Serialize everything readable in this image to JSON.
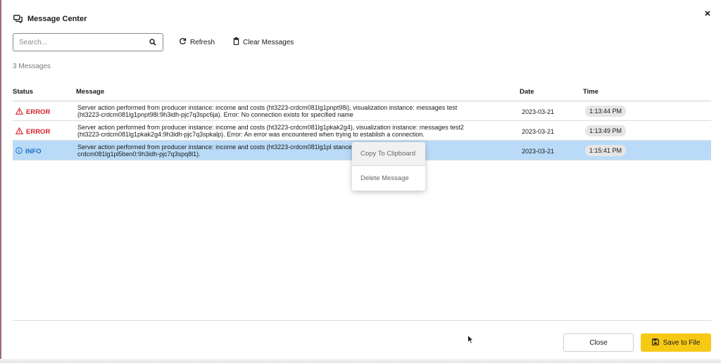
{
  "dialog": {
    "title": "Message Center",
    "close_icon": "close-icon",
    "title_icon": "chat-bubbles-icon"
  },
  "toolbar": {
    "search_placeholder": "Search...",
    "search_icon": "search-icon",
    "refresh_label": "Refresh",
    "refresh_icon": "refresh-icon",
    "clear_label": "Clear Messages",
    "clear_icon": "trash-icon"
  },
  "count_text": "3 Messages",
  "table": {
    "headers": [
      "Status",
      "Message",
      "Date",
      "Time"
    ],
    "rows": [
      {
        "status": "ERROR",
        "status_icon": "warning-triangle-icon",
        "message": "Server action performed from producer instance: income and costs (ht3223-crdcm081lg1pnpt98i), visualization instance: messages test\n(ht3223-crdcm081lg1pnpt98i:9h3idh-pjc7q3spc6ja). Error: No connection exists for specified name",
        "date": "2023-03-21",
        "time": "1:13:44 PM"
      },
      {
        "status": "ERROR",
        "status_icon": "warning-triangle-icon",
        "message": "Server action performed from producer instance: income and costs (ht3223-crdcm081lg1pkak2g4), visualization instance: messages test2\n(ht3223-crdcm081lg1pkak2g4:9h3idh-pjc7q3spkalp). Error: An error was encountered when trying to establish a connection.",
        "date": "2023-03-21",
        "time": "1:13:49 PM"
      },
      {
        "status": "INFO",
        "status_icon": "info-circle-icon",
        "message": "Server action performed from producer instance: income and costs (ht3223-crdcm081lg1pl                                    stance: messages3 (ht3223-\ncrdcm081lg1pl5ben0:9h3idh-pjc7q3spq8l1).",
        "date": "2023-03-21",
        "time": "1:15:41 PM"
      }
    ]
  },
  "context_menu": {
    "items": [
      "Copy To Clipboard",
      "Delete Message"
    ]
  },
  "footer": {
    "close_label": "Close",
    "save_label": "Save to File",
    "save_icon": "floppy-disk-icon"
  },
  "colors": {
    "error": "#d6232b",
    "info": "#1a6fc0",
    "selected_row": "#b9dbf7",
    "save_button": "#f6c915"
  }
}
